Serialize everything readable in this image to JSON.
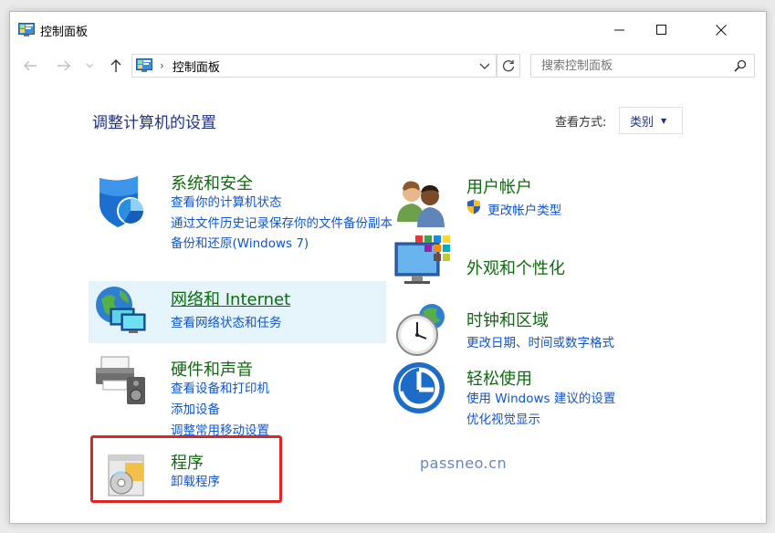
{
  "window": {
    "title": "控制面板"
  },
  "nav": {
    "breadcrumb_sep": "›",
    "address": "控制面板",
    "search_placeholder": "搜索控制面板"
  },
  "header": {
    "title": "调整计算机的设置",
    "view_label": "查看方式:",
    "view_value": "类别"
  },
  "categories": {
    "system": {
      "title": "系统和安全",
      "links": [
        "查看你的计算机状态",
        "通过文件历史记录保存你的文件备份副本",
        "备份和还原(Windows 7)"
      ]
    },
    "network": {
      "title": "网络和 Internet",
      "links": [
        "查看网络状态和任务"
      ]
    },
    "hardware": {
      "title": "硬件和声音",
      "links": [
        "查看设备和打印机",
        "添加设备",
        "调整常用移动设置"
      ]
    },
    "programs": {
      "title": "程序",
      "links": [
        "卸载程序"
      ]
    },
    "user": {
      "title": "用户帐户",
      "links": [
        "更改帐户类型"
      ]
    },
    "appearance": {
      "title": "外观和个性化",
      "links": []
    },
    "clock": {
      "title": "时钟和区域",
      "links": [
        "更改日期、时间或数字格式"
      ]
    },
    "ease": {
      "title": "轻松使用",
      "links": [
        "使用 Windows 建议的设置",
        "优化视觉显示"
      ]
    }
  },
  "watermark": "passneo.cn",
  "colors": {
    "category_title": "#0e6b0e",
    "link": "#1155cc",
    "heading": "#1e3287",
    "highlight": "#e5f3fb",
    "annotation": "#e02424"
  }
}
